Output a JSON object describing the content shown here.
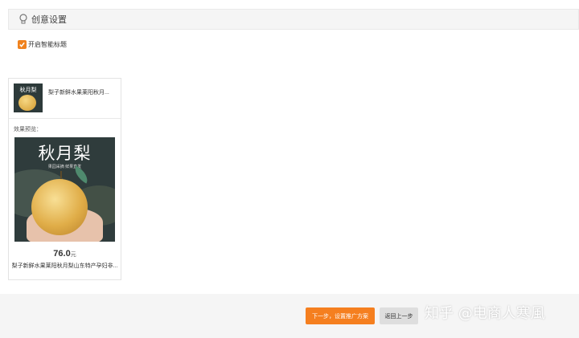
{
  "section": {
    "title": "创意设置",
    "icon": "lightbulb-icon"
  },
  "smart_title": {
    "label": "开启智能标题",
    "checked": true
  },
  "creative_card": {
    "thumb_title": "秋月梨",
    "title": "梨子新鲜水果莱阳秋月...",
    "preview_label": "效果预览：",
    "image_title": "秋月梨",
    "image_subtitle": "果园采摘  鲜果直发",
    "price": "76.0",
    "price_unit": "元",
    "product_name": "梨子新鲜水果莱阳秋月梨山东特产孕妇非..."
  },
  "footer": {
    "next_label": "下一步，设置推广方案",
    "back_label": "返回上一步"
  },
  "watermark": "知乎 @电商人寒風",
  "colors": {
    "accent": "#f57f1f"
  }
}
